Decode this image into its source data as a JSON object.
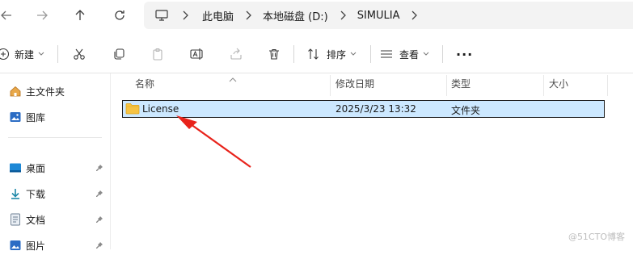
{
  "address_bar": {
    "breadcrumbs": [
      "此电脑",
      "本地磁盘 (D:)",
      "SIMULIA"
    ]
  },
  "command_bar": {
    "new_label": "新建",
    "sort_label": "排序",
    "view_label": "查看",
    "more_label": "..."
  },
  "nav_pane": {
    "items": [
      {
        "label": "主文件夹",
        "icon": "home-icon"
      },
      {
        "label": "图库",
        "icon": "gallery-icon"
      },
      {
        "label": "桌面",
        "icon": "desktop-icon",
        "pinned": true
      },
      {
        "label": "下载",
        "icon": "download-icon",
        "pinned": true
      },
      {
        "label": "文档",
        "icon": "document-icon",
        "pinned": true
      },
      {
        "label": "图片",
        "icon": "pictures-icon",
        "pinned": true
      }
    ]
  },
  "file_list": {
    "columns": [
      "名称",
      "修改日期",
      "类型",
      "大小"
    ],
    "rows": [
      {
        "name": "License",
        "modified": "2025/3/23 13:32",
        "type": "文件夹",
        "size": ""
      }
    ]
  },
  "watermark": "@51CTO博客",
  "colors": {
    "selection": "#cce8ff",
    "folder": "#f6c343",
    "arrow": "#e8231b"
  }
}
